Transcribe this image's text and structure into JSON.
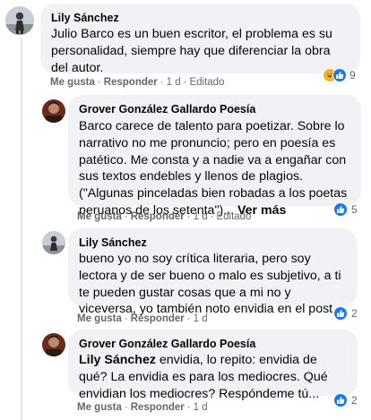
{
  "comments": [
    {
      "author": "Lily Sánchez",
      "text": "Julio Barco es un buen escritor, el problema es su personalidad, siempre hay que diferenciar la obra del autor.",
      "like": "Me gusta",
      "reply": "Responder",
      "time": "1 d",
      "edited": "Editado",
      "reactions": [
        "haha-icon",
        "like-icon"
      ],
      "reaction_count": "9"
    },
    {
      "author": "Grover González Gallardo Poesía",
      "text": "Barco carece de talento para poetizar. Sobre lo narrativo no me pronuncio; pero en poesía es patético. Me consta y a nadie va a engañar con sus textos endebles y llenos de plagios. (\"Algunas pinceladas bien robadas a los poetas peruanos de los setenta\")...",
      "more": "Ver más",
      "like": "Me gusta",
      "reply": "Responder",
      "time": "1 d",
      "edited": "Editado",
      "reactions": [
        "like-icon"
      ],
      "reaction_count": "5"
    },
    {
      "author": "Lily Sánchez",
      "text": "bueno yo no soy crítica literaria, pero soy lectora y de ser bueno o malo es subjetivo, a ti te pueden gustar cosas que a mi no y viceversa, yo también noto envidia en el post.",
      "like": "Me gusta",
      "reply": "Responder",
      "time": "1 d",
      "reactions": [
        "like-icon"
      ],
      "reaction_count": "2"
    },
    {
      "author": "Grover González Gallardo Poesía",
      "mention": "Lily Sánchez",
      "text": " envidia, lo repito: envidia de qué? La envidia es para los mediocres. Qué envidian los mediocres? Respóndeme tú...",
      "like": "Me gusta",
      "reply": "Responder",
      "time": "1 d",
      "reactions": [
        "like-icon"
      ],
      "reaction_count": "2"
    }
  ]
}
